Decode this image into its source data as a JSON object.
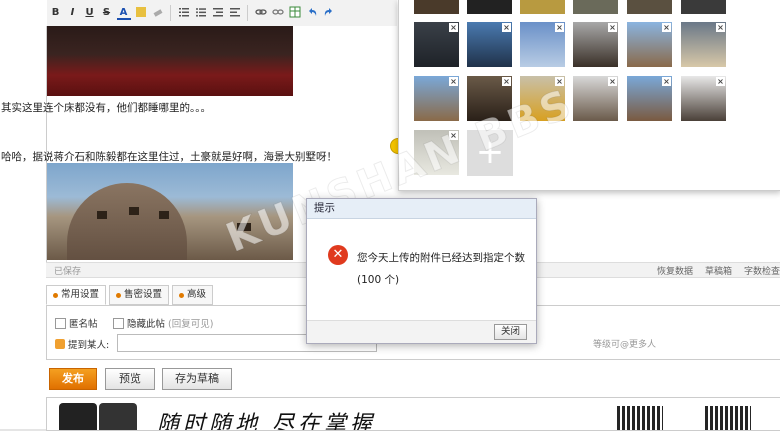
{
  "toolbar": {
    "buttons": [
      "B",
      "I",
      "U",
      "S",
      "A"
    ],
    "emoji_label": "表情"
  },
  "editor": {
    "line1": "其实这里连个床都没有，他们都睡哪里的。。。",
    "line2": "哈哈，据说蒋介石和陈毅都在这里住过，土豪就是好啊，海景大别墅呀！"
  },
  "statusbar": {
    "saved": "已保存",
    "restore": "恢复数据",
    "drafts": "草稿箱",
    "wordcheck": "字数检查"
  },
  "tabs": [
    {
      "label": "常用设置"
    },
    {
      "label": "售密设置"
    },
    {
      "label": "高级"
    }
  ],
  "options": {
    "anonymous": "匿名帖",
    "hide": "隐藏此帖",
    "hide_hint": "(回复可见)",
    "mention_label": "提到某人:",
    "mention_tip": "等级可@更多人"
  },
  "actions": {
    "publish": "发布",
    "preview": "预览",
    "save_draft": "存为草稿"
  },
  "banner": {
    "slogan": "随时随地 尽在掌握"
  },
  "modal": {
    "title": "提示",
    "message": "您今天上传的附件已经达到指定个数(100 个)",
    "close": "关闭"
  },
  "upload": {
    "add": "+"
  },
  "watermark": "KUNSHAN BBS",
  "colors": {
    "accent": "#e07000",
    "error": "#e03a1e"
  }
}
